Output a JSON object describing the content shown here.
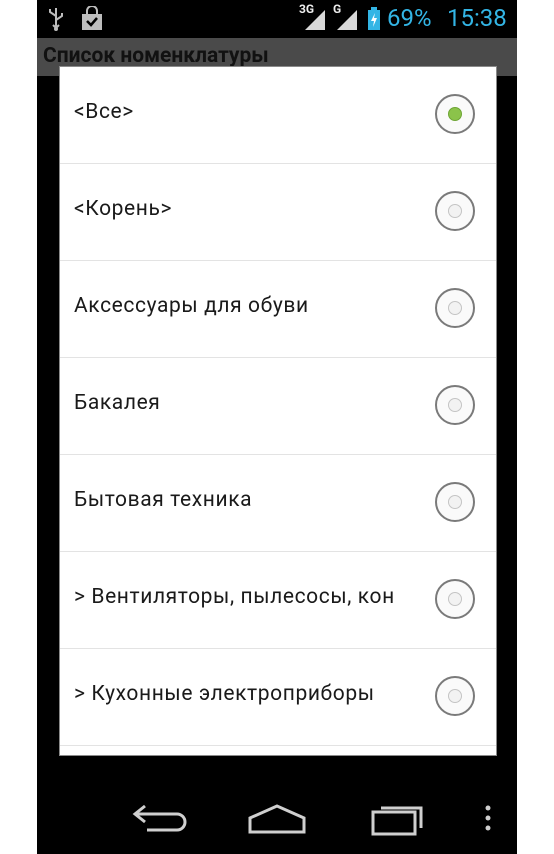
{
  "status_bar": {
    "battery_percent": "69%",
    "time": "15:38",
    "network_labels": [
      "3G",
      "G"
    ],
    "left_icons": [
      "usb-icon",
      "shopping-bag-icon"
    ],
    "accent_color": "#33b5e5"
  },
  "activity": {
    "title": "Список номенклатуры"
  },
  "dialog": {
    "items": [
      {
        "label": "<Все>",
        "selected": true
      },
      {
        "label": "<Корень>",
        "selected": false
      },
      {
        "label": "Аксессуары для обуви",
        "selected": false
      },
      {
        "label": "Бакалея",
        "selected": false
      },
      {
        "label": "Бытовая техника",
        "selected": false
      },
      {
        "label": "> Вентиляторы, пылесосы, кон",
        "selected": false
      },
      {
        "label": "> Кухонные электроприборы",
        "selected": false
      }
    ],
    "selected_color": "#8bc34a"
  },
  "nav_bar": {
    "buttons": [
      "back-icon",
      "home-icon",
      "recent-apps-icon",
      "menu-icon"
    ]
  }
}
